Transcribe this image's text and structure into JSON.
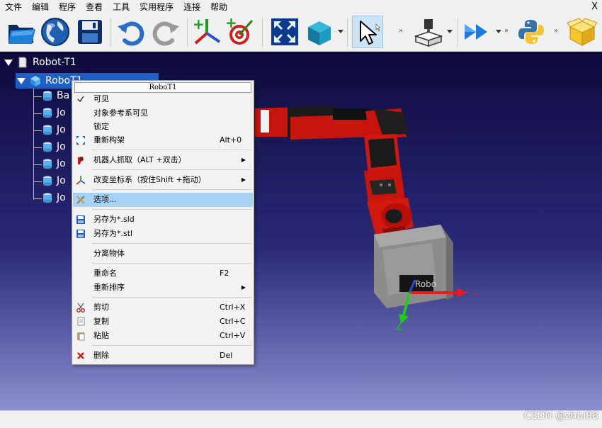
{
  "menubar": {
    "items": [
      "文件",
      "编辑",
      "程序",
      "查看",
      "工具",
      "实用程序",
      "连接",
      "帮助"
    ],
    "close": "X"
  },
  "toolbar": {
    "icons": [
      "open-folder-icon",
      "globe-icon",
      "save-icon",
      "undo-icon",
      "redo-icon",
      "add-frame-icon",
      "add-target-icon",
      "fit-all-icon",
      "view-cube-icon",
      "select-pointer-icon",
      "machining-icon",
      "run-program-icon",
      "python-icon",
      "package-icon"
    ],
    "overflow": "»",
    "colors": {
      "selected_bg": "#cde4f7"
    }
  },
  "tree": {
    "root": "Robot-T1",
    "robot": "RoboT1",
    "children": [
      "Ba",
      "Jo",
      "Jo",
      "Jo",
      "Jo",
      "Jo",
      "Jo"
    ]
  },
  "context_menu": {
    "title": "RoboT1",
    "items": [
      {
        "label": "可见",
        "shortcut": "",
        "icon": "check-icon"
      },
      {
        "label": "对象参考系可见",
        "shortcut": "",
        "icon": ""
      },
      {
        "label": "锁定",
        "shortcut": "",
        "icon": ""
      },
      {
        "label": "重新构架",
        "shortcut": "Alt+0",
        "icon": "fit-all-icon"
      },
      {
        "label": "机器人抓取（ALT +双击）",
        "shortcut": "",
        "icon": "robot-grab-icon"
      },
      {
        "label": "改变坐标系（按住Shift +拖动）",
        "shortcut": "",
        "icon": "coordinate-axes-icon"
      },
      {
        "label": "选项...",
        "shortcut": "",
        "icon": "tools-icon"
      },
      {
        "label": "另存为*.sld",
        "shortcut": "",
        "icon": "save-icon"
      },
      {
        "label": "另存为*.stl",
        "shortcut": "",
        "icon": "save-icon"
      },
      {
        "label": "分离物体",
        "shortcut": "",
        "icon": ""
      },
      {
        "label": "重命名",
        "shortcut": "F2",
        "icon": ""
      },
      {
        "label": "重新排序",
        "shortcut": "",
        "icon": ""
      },
      {
        "label": "剪切",
        "shortcut": "Ctrl+X",
        "icon": "scissors-icon"
      },
      {
        "label": "复制",
        "shortcut": "Ctrl+C",
        "icon": "copy-icon"
      },
      {
        "label": "粘贴",
        "shortcut": "Ctrl+V",
        "icon": "paste-icon"
      },
      {
        "label": "删除",
        "shortcut": "Del",
        "icon": "delete-icon"
      }
    ],
    "highlighted": "选项...",
    "submenu_arrow": "▶"
  },
  "viewport": {
    "robot_label": "Robo",
    "colors": {
      "robot": "#d0180f",
      "tool": "#8c8c8c",
      "bg_top": "#0c0a3c",
      "bg_bottom": "#8a8fcf"
    }
  },
  "watermark": "CSDN @zhbi98"
}
